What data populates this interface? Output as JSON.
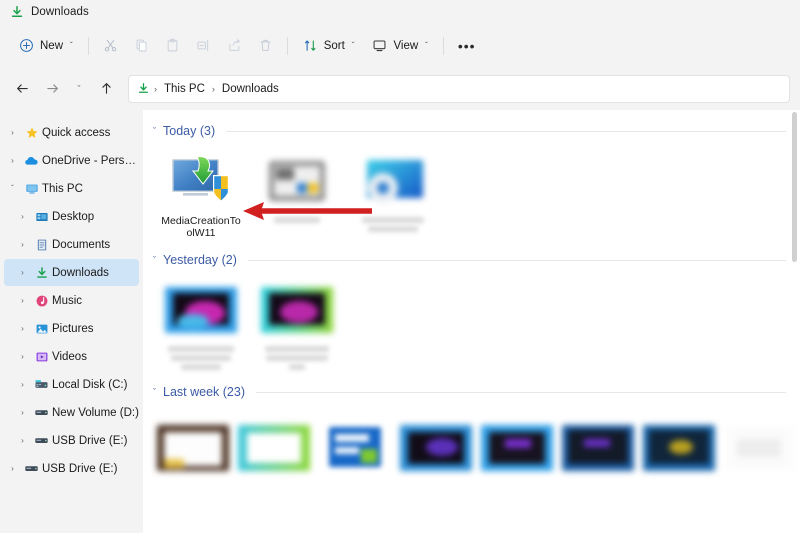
{
  "window": {
    "title": "Downloads",
    "title_icon": "downloads-arrow-icon"
  },
  "toolbar": {
    "new_label": "New",
    "new_icon": "plus-circle-icon",
    "cut_icon": "scissors-icon",
    "copy_icon": "copy-icon",
    "paste_icon": "clipboard-icon",
    "rename_icon": "rename-icon",
    "share_icon": "share-icon",
    "delete_icon": "trash-icon",
    "sort_label": "Sort",
    "sort_icon": "sort-arrows-icon",
    "view_label": "View",
    "view_icon": "monitor-icon",
    "more_label": "•••",
    "chevron": "ˇ"
  },
  "address": {
    "back_icon": "arrow-left-icon",
    "forward_icon": "arrow-right-icon",
    "recent_icon": "chevron-down-icon",
    "up_icon": "arrow-up-icon",
    "path_icon": "downloads-arrow-icon",
    "crumbs": [
      "This PC",
      "Downloads"
    ],
    "separator": "›"
  },
  "sidebar": {
    "items": [
      {
        "label": "Quick access",
        "icon": "star-icon",
        "twisty": "›",
        "indent": 0,
        "selected": false
      },
      {
        "label": "OneDrive - Personal",
        "icon": "cloud-icon",
        "twisty": "›",
        "indent": 0,
        "selected": false
      },
      {
        "label": "This PC",
        "icon": "pc-icon",
        "twisty": "ˇ",
        "indent": 0,
        "selected": false
      },
      {
        "label": "Desktop",
        "icon": "desktop-icon",
        "twisty": "›",
        "indent": 1,
        "selected": false
      },
      {
        "label": "Documents",
        "icon": "documents-icon",
        "twisty": "›",
        "indent": 1,
        "selected": false
      },
      {
        "label": "Downloads",
        "icon": "downloads-icon",
        "twisty": "›",
        "indent": 1,
        "selected": true
      },
      {
        "label": "Music",
        "icon": "music-icon",
        "twisty": "›",
        "indent": 1,
        "selected": false
      },
      {
        "label": "Pictures",
        "icon": "pictures-icon",
        "twisty": "›",
        "indent": 1,
        "selected": false
      },
      {
        "label": "Videos",
        "icon": "videos-icon",
        "twisty": "›",
        "indent": 1,
        "selected": false
      },
      {
        "label": "Local Disk (C:)",
        "icon": "system-drive-icon",
        "twisty": "›",
        "indent": 1,
        "selected": false
      },
      {
        "label": "New Volume (D:)",
        "icon": "drive-icon",
        "twisty": "›",
        "indent": 1,
        "selected": false
      },
      {
        "label": "USB Drive (E:)",
        "icon": "usb-drive-icon",
        "twisty": "›",
        "indent": 1,
        "selected": false
      },
      {
        "label": "USB Drive (E:)",
        "icon": "usb-drive-icon",
        "twisty": "›",
        "indent": 0,
        "selected": false
      }
    ]
  },
  "content": {
    "groups": [
      {
        "header": "Today (3)",
        "chevron": "ˇ",
        "items": [
          {
            "name": "MediaCreationToolW11",
            "icon": "media-creation-tool-icon",
            "blurred": false
          },
          {
            "name": "",
            "icon": "blurred-thumbnail-gray",
            "blurred": true
          },
          {
            "name": "",
            "icon": "blurred-thumbnail-blue-monitor",
            "blurred": true
          }
        ]
      },
      {
        "header": "Yesterday (2)",
        "chevron": "ˇ",
        "items": [
          {
            "name": "",
            "icon": "blurred-thumbnail-blue-video",
            "blurred": true
          },
          {
            "name": "",
            "icon": "blurred-thumbnail-green-video",
            "blurred": true
          }
        ]
      },
      {
        "header": "Last week (23)",
        "chevron": "ˇ",
        "items": [
          {
            "name": "",
            "icon": "blurred-thumbnail-brown",
            "blurred": true
          },
          {
            "name": "",
            "icon": "blurred-thumbnail-cyangreen",
            "blurred": true
          },
          {
            "name": "",
            "icon": "blurred-thumbnail-blue-flag",
            "blurred": true
          },
          {
            "name": "",
            "icon": "blurred-thumbnail-blue-dark",
            "blurred": true
          },
          {
            "name": "",
            "icon": "blurred-thumbnail-brightblue",
            "blurred": true
          },
          {
            "name": "",
            "icon": "blurred-thumbnail-navy",
            "blurred": true
          },
          {
            "name": "",
            "icon": "blurred-thumbnail-navy-yellow",
            "blurred": true
          },
          {
            "name": "",
            "icon": "blurred-thumbnail-white",
            "blurred": true
          }
        ]
      }
    ]
  },
  "annotation": {
    "arrow_color": "#d02020",
    "arrow_direction": "left",
    "points_to": "MediaCreationToolW11"
  },
  "colors": {
    "chrome": "#f3f3f3",
    "content_bg": "#ffffff",
    "selection": "#cfe4f7",
    "group_header": "#3b5ba5",
    "accent_green": "#17a04a",
    "text": "#1b1b1b"
  }
}
